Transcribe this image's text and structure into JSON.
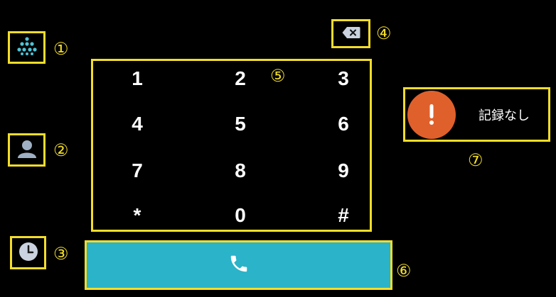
{
  "sidebar": {
    "dialpad_marker": "①",
    "contacts_marker": "②",
    "history_marker": "③"
  },
  "backspace": {
    "marker": "④"
  },
  "keypad": {
    "marker": "⑤",
    "keys": [
      "1",
      "2",
      "3",
      "4",
      "5",
      "6",
      "7",
      "8",
      "9",
      "*",
      "0",
      "#"
    ]
  },
  "call": {
    "marker": "⑥"
  },
  "history": {
    "marker": "⑦",
    "empty_text": "記録なし"
  },
  "colors": {
    "highlight": "#f2dd2a",
    "call_button": "#2ab3c9",
    "alert": "#e0602c",
    "icon": "#4fc3d6"
  },
  "icons": [
    "dialpad-icon",
    "contacts-icon",
    "history-icon",
    "backspace-icon",
    "phone-icon",
    "alert-icon"
  ]
}
